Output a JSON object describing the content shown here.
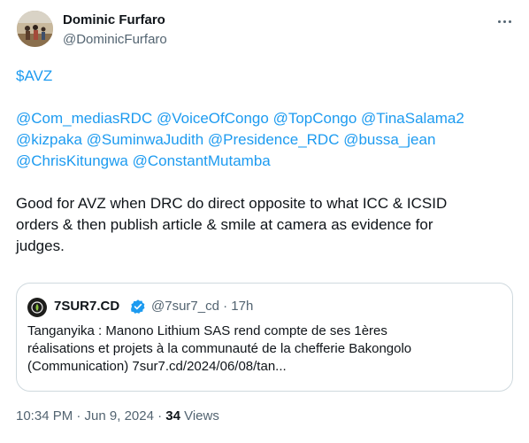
{
  "author": {
    "name": "Dominic Furfaro",
    "handle": "@DominicFurfaro"
  },
  "tweet": {
    "cashtag": "$AVZ",
    "mention_lines": [
      "@Com_mediasRDC @VoiceOfCongo @TopCongo @TinaSalama2",
      "@kizpaka @SuminwaJudith @Presidence_RDC @bussa_jean",
      "@ChrisKitungwa @ConstantMutamba"
    ],
    "body_lines": [
      "Good for AVZ when DRC do direct opposite to what ICC & ICSID",
      "orders & then publish article & smile at camera as evidence for",
      "judges."
    ]
  },
  "quote": {
    "name": "7SUR7.CD",
    "handle_time": "@7sur7_cd · 17h",
    "text_lines": [
      "Tanganyika : Manono Lithium SAS rend compte de ses 1ères",
      "réalisations et projets à la communauté de la chefferie Bakongolo",
      "(Communication) 7sur7.cd/2024/06/08/tan..."
    ]
  },
  "meta": {
    "time_date": "10:34 PM · Jun 9, 2024 · ",
    "views_count": "34",
    "views_label": " Views"
  },
  "colors": {
    "link": "#1d9bf0",
    "text": "#0f1419",
    "secondary": "#536471",
    "border": "#cfd9de"
  }
}
